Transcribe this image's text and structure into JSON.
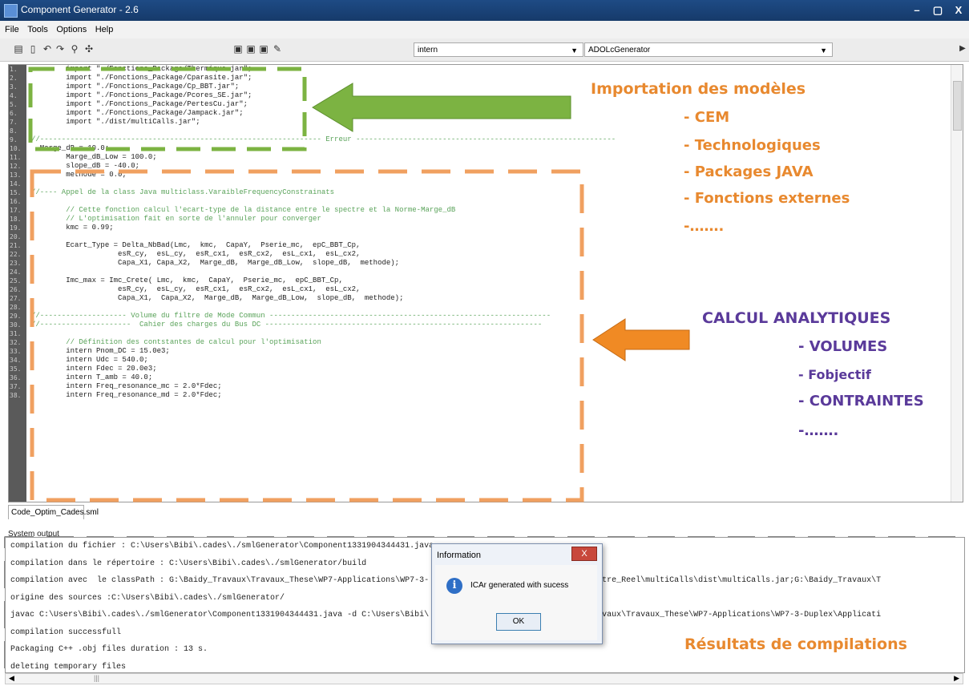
{
  "window": {
    "title": "Component Generator - 2.6",
    "controls": [
      "–",
      "▢",
      "X"
    ]
  },
  "menu": [
    "File",
    "Tools",
    "Options",
    "Help"
  ],
  "toolbar": {
    "combo1_value": "intern",
    "combo2_value": "ADOLcGenerator"
  },
  "editor": {
    "line_numbers": [
      "1.",
      "2.",
      "3.",
      "4.",
      "5.",
      "6.",
      "7.",
      "8.",
      "9.",
      "10.",
      "11.",
      "12.",
      "13.",
      "14.",
      "15.",
      "16.",
      "17.",
      "18.",
      "19.",
      "20.",
      "21.",
      "22.",
      "23.",
      "24.",
      "25.",
      "26.",
      "27.",
      "28.",
      "29.",
      "30.",
      "31.",
      "32.",
      "33.",
      "34.",
      "35.",
      "36.",
      "37.",
      "38."
    ],
    "lines": [
      "        import \"./Fonctions_Package/Thermique.jar\";",
      "        import \"./Fonctions_Package/Cparasite.jar\";",
      "        import \"./Fonctions_Package/Cp_BBT.jar\";",
      "        import \"./Fonctions_Package/Pcores_SE.jar\";",
      "        import \"./Fonctions_Package/PertesCu.jar\";",
      "        import \"./Fonctions_Package/Jampack.jar\";",
      "        import \"./dist/multiCalls.jar\";",
      "",
      "//----------------------------------------------------------------- Erreur ------------------------------------------------------------",
      "  Marge_dB = 10.0;",
      "        Marge_dB_Low = 100.0;",
      "        slope_dB = -40.0;",
      "        methode = 0.0;",
      "",
      "//---- Appel de la class Java multiclass.VaraibleFrequencyConstrainats",
      "",
      "        // Cette fonction calcul l'ecart-type de la distance entre le spectre et la Norme-Marge_dB",
      "        // L'optimisation fait en sorte de l'annuler pour converger",
      "        kmc = 0.99;",
      "",
      "        Ecart_Type = Delta_NbBad(Lmc,  kmc,  CapaY,  Pserie_mc,  epC_BBT_Cp,",
      "                    esR_cy,  esL_cy,  esR_cx1,  esR_cx2,  esL_cx1,  esL_cx2,",
      "                    Capa_X1, Capa_X2,  Marge_dB,  Marge_dB_Low,  slope_dB,  methode);",
      "",
      "        Imc_max = Imc_Crete( Lmc,  kmc,  CapaY,  Pserie_mc,  epC_BBT_Cp,",
      "                    esR_cy,  esL_cy,  esR_cx1,  esR_cx2,  esL_cx1,  esL_cx2,",
      "                    Capa_X1,  Capa_X2,  Marge_dB,  Marge_dB_Low,  slope_dB,  methode);",
      "",
      "//-------------------- Volume du filtre de Mode Commun -----------------------------------------------------------------",
      "//---------------------  Cahier des charges du Bus DC ----------------------------------------------------------------",
      "",
      "        // Définition des contstantes de calcul pour l'optimisation",
      "        intern Pnom_DC = 15.0e3;",
      "        intern Udc = 540.0;",
      "        intern Fdec = 20.0e3;",
      "        intern T_amb = 40.0;",
      "        intern Freq_resonance_mc = 2.0*Fdec;",
      "        intern Freq_resonance_md = 2.0*Fdec;"
    ]
  },
  "tab_label": "Code_Optim_Cades.sml",
  "system_output": {
    "label": "System output",
    "lines": [
      "compilation du fichier : C:\\Users\\Bibi\\.cades\\./smlGenerator\\Component1331904344431.java",
      "compilation dans le répertoire : C:\\Users\\Bibi\\.cades\\./smlGenerator/build",
      "compilation avec  le classPath : G:\\Baidy_Travaux\\Travaux_These\\WP7-Applications\\WP7-3-                    Optimisation_Filtre_Reel\\multiCalls\\dist\\multiCalls.jar;G:\\Baidy_Travaux\\T",
      "origine des sources :C:\\Users\\Bibi\\.cades\\./smlGenerator/",
      "javac C:\\Users\\Bibi\\.cades\\./smlGenerator\\Component1331904344431.java -d C:\\Users\\Bibi\\                    ath G:\\Baidy_Travaux\\Travaux_These\\WP7-Applications\\WP7-3-Duplex\\Applicati",
      "compilation successfull",
      "Packaging C++ .obj files duration : 13 s.",
      "deleting temporary files"
    ]
  },
  "dialog": {
    "title": "Information",
    "close": "X",
    "message": "ICAr generated with sucess",
    "ok": "OK"
  },
  "annotations": {
    "import_title": "Importation des modèles",
    "import_items": [
      "- CEM",
      "- Technologiques",
      "- Packages JAVA",
      "- Fonctions externes",
      "-……."
    ],
    "calc_title": "CALCUL ANALYTIQUES",
    "calc_items": [
      "- VOLUMES",
      "- Fobjectif",
      "- CONTRAINTES",
      "-……."
    ],
    "results": "Résultats de compilations"
  },
  "colors": {
    "orange": "#e8892f",
    "purple": "#5a3a9a",
    "green_arrow": "#7cb342",
    "orange_arrow": "#f08a24",
    "blue_arrow": "#3aa3c8",
    "code_keyword": "#7a3aa0",
    "code_string": "#2e7d32",
    "code_number": "#c2185b",
    "code_comment": "#5aa35a"
  }
}
